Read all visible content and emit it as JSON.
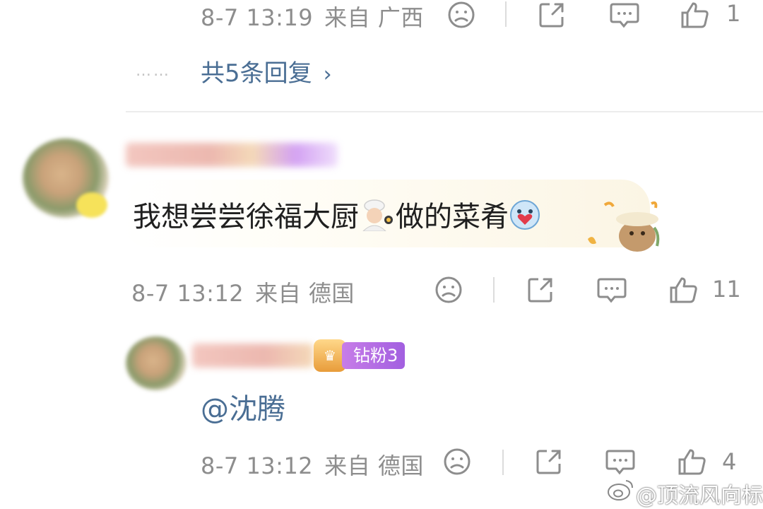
{
  "top_reply": {
    "date": "8-7 13:19",
    "from_label": "来自",
    "location": "广西",
    "like_count": "1"
  },
  "more_replies": {
    "dots": "……",
    "label": "共5条回复",
    "chevron": "›"
  },
  "comment": {
    "text_part1": "我想尝尝徐福大厨",
    "text_part2": "做的菜肴",
    "date": "8-7 13:12",
    "from_label": "来自",
    "location": "德国",
    "like_count": "11"
  },
  "reply": {
    "badge_label": "钻粉3",
    "text": "@沈腾",
    "date": "8-7 13:12",
    "from_label": "来自",
    "location": "德国",
    "like_count": "4"
  },
  "watermark": "@顶流风向标",
  "icons": {
    "dislike": "sad-face-icon",
    "share": "share-icon",
    "comment": "comment-icon",
    "like": "thumbs-up-icon"
  },
  "colors": {
    "link": "#4a6e94",
    "meta": "#8d8d8d",
    "badge": "#b06be6"
  }
}
